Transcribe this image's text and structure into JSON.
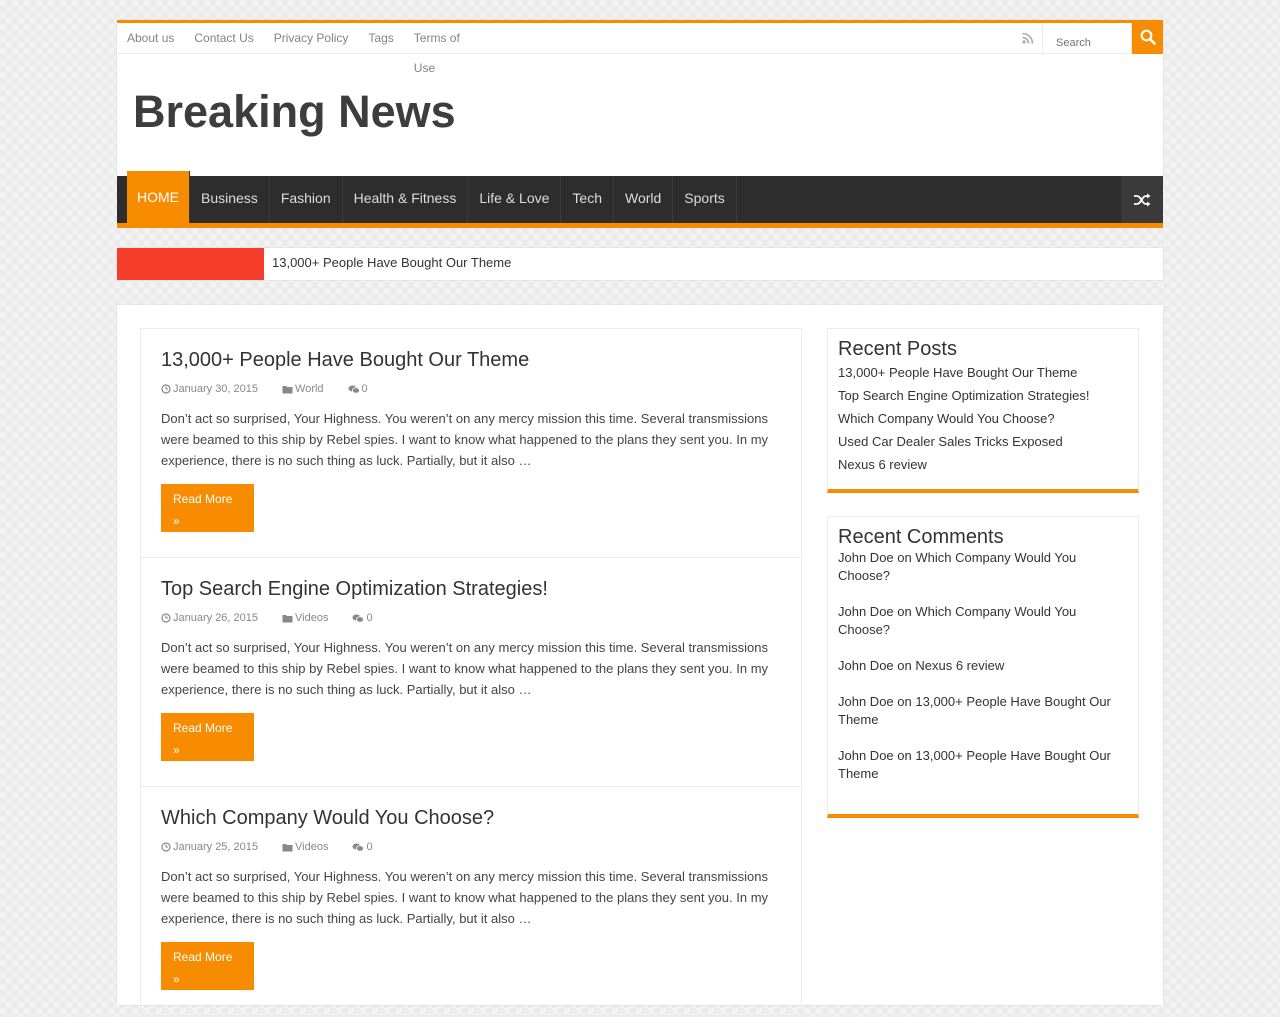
{
  "topnav": {
    "links": [
      "About us",
      "Contact Us",
      "Privacy Policy",
      "Tags",
      "Terms of Use"
    ],
    "search_placeholder": "Search"
  },
  "site": {
    "title": "Breaking News"
  },
  "mainnav": {
    "items": [
      "HOME",
      "Business",
      "Fashion",
      "Health & Fitness",
      "Life & Love",
      "Tech",
      "World",
      "Sports"
    ]
  },
  "ticker": {
    "headline": "13,000+ People Have Bought Our Theme"
  },
  "posts": [
    {
      "title": "13,000+ People Have Bought Our Theme",
      "date": "January 30, 2015",
      "category": "World",
      "comments": "0",
      "excerpt": "Don’t act so surprised, Your Highness. You weren’t on any mercy mission this time. Several transmissions were beamed to this ship by Rebel spies. I want to know what happened to the plans they sent you. In my experience, there is no such thing as luck. Partially, but it also …",
      "readmore": "Read More »"
    },
    {
      "title": "Top Search Engine Optimization Strategies!",
      "date": "January 26, 2015",
      "category": "Videos",
      "comments": "0",
      "excerpt": "Don’t act so surprised, Your Highness. You weren’t on any mercy mission this time. Several transmissions were beamed to this ship by Rebel spies. I want to know what happened to the plans they sent you. In my experience, there is no such thing as luck. Partially, but it also …",
      "readmore": "Read More »"
    },
    {
      "title": "Which Company Would You Choose?",
      "date": "January 25, 2015",
      "category": "Videos",
      "comments": "0",
      "excerpt": "Don’t act so surprised, Your Highness. You weren’t on any mercy mission this time. Several transmissions were beamed to this ship by Rebel spies. I want to know what happened to the plans they sent you. In my experience, there is no such thing as luck. Partially, but it also …",
      "readmore": "Read More »"
    }
  ],
  "recent_posts": {
    "title": "Recent Posts",
    "items": [
      "13,000+ People Have Bought Our Theme",
      "Top Search Engine Optimization Strategies!",
      "Which Company Would You Choose?",
      "Used Car Dealer Sales Tricks Exposed",
      "Nexus 6 review"
    ]
  },
  "recent_comments": {
    "title": "Recent Comments",
    "connector": "on",
    "items": [
      {
        "author": "John Doe",
        "post": "Which Company Would You Choose?"
      },
      {
        "author": "John Doe",
        "post": "Which Company Would You Choose?"
      },
      {
        "author": "John Doe",
        "post": "Nexus 6 review"
      },
      {
        "author": "John Doe",
        "post": "13,000+ People Have Bought Our Theme"
      },
      {
        "author": "John Doe",
        "post": "13,000+ People Have Bought Our Theme"
      }
    ]
  },
  "colors": {
    "accent": "#f88c00",
    "ticker_label": "#f63d2a",
    "nav_bg": "#2d2d2d"
  },
  "icons": [
    "rss-icon",
    "search-icon",
    "shuffle-icon",
    "clock-icon",
    "folder-icon",
    "comments-icon"
  ]
}
